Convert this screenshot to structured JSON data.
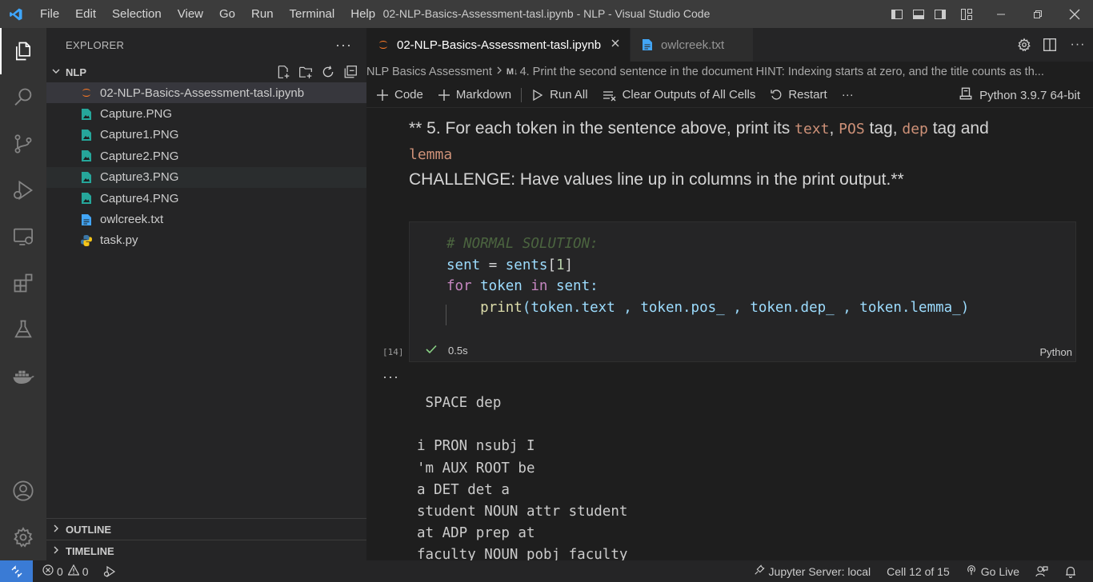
{
  "window": {
    "title": "02-NLP-Basics-Assessment-tasl.ipynb - NLP - Visual Studio Code",
    "menu": [
      "File",
      "Edit",
      "Selection",
      "View",
      "Go",
      "Run",
      "Terminal",
      "Help"
    ]
  },
  "sidebar": {
    "title": "EXPLORER",
    "more": "···",
    "folder": "NLP",
    "files": [
      {
        "name": "02-NLP-Basics-Assessment-tasl.ipynb",
        "icon": "jupyter-icon"
      },
      {
        "name": "Capture.PNG",
        "icon": "image-file-icon"
      },
      {
        "name": "Capture1.PNG",
        "icon": "image-file-icon"
      },
      {
        "name": "Capture2.PNG",
        "icon": "image-file-icon"
      },
      {
        "name": "Capture3.PNG",
        "icon": "image-file-icon"
      },
      {
        "name": "Capture4.PNG",
        "icon": "image-file-icon"
      },
      {
        "name": "owlcreek.txt",
        "icon": "text-file-icon"
      },
      {
        "name": "task.py",
        "icon": "python-icon"
      }
    ],
    "outline": "OUTLINE",
    "timeline": "TIMELINE"
  },
  "editor": {
    "tabs": [
      {
        "label": "02-NLP-Basics-Assessment-tasl.ipynb",
        "active": true
      },
      {
        "label": "owlcreek.txt",
        "active": false
      }
    ],
    "breadcrumb": {
      "part1": "NLP Basics Assessment",
      "md": "M↓",
      "part2": "4. Print the second sentence in the document HINT: Indexing starts at zero, and the title counts as th..."
    },
    "toolbar": {
      "code": "Code",
      "markdown": "Markdown",
      "run_all": "Run All",
      "clear_outputs": "Clear Outputs of All Cells",
      "restart": "Restart",
      "more": "···",
      "kernel": "Python 3.9.7 64-bit"
    },
    "markdown": {
      "prefix": "** 5. For each token in the sentence above, print its ",
      "c1": "text",
      "s1": ", ",
      "c2": "POS",
      "s2": " tag, ",
      "c3": "dep",
      "s3": " tag and",
      "c4": "lemma",
      "line2": "CHALLENGE: Have values line up in columns in the print output.**"
    },
    "code": {
      "comment": "# NORMAL SOLUTION:",
      "l2a": "sent",
      "l2b": " = ",
      "l2c": "sents",
      "l2d": "[",
      "l2e": "1",
      "l2f": "]",
      "l3a": "for",
      "l3b": " token ",
      "l3c": "in",
      "l3d": " sent:",
      "l4a": "print",
      "l4b": "(token.text , token.pos_ , token.dep_ , token.lemma_)"
    },
    "exec_count": "[14]",
    "exec_time": "0.5s",
    "language": "Python",
    "output_dots": "···",
    "output_lines": [
      " SPACE dep",
      "",
      "i PRON nsubj I",
      "'m AUX ROOT be",
      "a DET det a",
      "student NOUN attr student",
      "at ADP prep at",
      "faculty NOUN pobj faculty"
    ]
  },
  "statusbar": {
    "errors": "0",
    "warnings": "0",
    "jupyter": "Jupyter Server: local",
    "cell": "Cell 12 of 15",
    "golive": "Go Live"
  },
  "colors": {
    "accent": "#007acc",
    "string_code": "#ce9178",
    "keyword": "#c586c0",
    "function": "#dcdcaa",
    "number": "#b5cea8",
    "check": "#89d185"
  }
}
